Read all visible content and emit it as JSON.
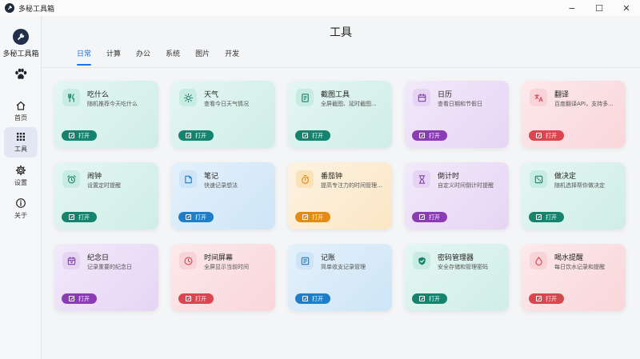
{
  "window": {
    "title": "多秘工具箱",
    "minimize": "−",
    "maximize": "☐",
    "close": "✕"
  },
  "sidebar": {
    "brand": "多秘工具箱",
    "items": [
      {
        "label": "首页",
        "icon": "home-icon"
      },
      {
        "label": "工具",
        "icon": "grid-icon",
        "active": true
      },
      {
        "label": "设置",
        "icon": "gear-icon"
      },
      {
        "label": "关于",
        "icon": "info-icon"
      }
    ]
  },
  "page": {
    "title": "工具"
  },
  "tabs": [
    {
      "label": "日常",
      "active": true
    },
    {
      "label": "计算"
    },
    {
      "label": "办公"
    },
    {
      "label": "系统"
    },
    {
      "label": "图片"
    },
    {
      "label": "开发"
    }
  ],
  "open_label": "打开",
  "colors": {
    "teal": "#16836f",
    "blue": "#1e7fc8",
    "purple": "#8a3cb4",
    "pink": "#d9464f",
    "orange": "#e48a16",
    "accent": "#1a73e8"
  },
  "tools": [
    {
      "name": "吃什么",
      "desc": "随机推荐今天吃什么",
      "icon": "fork-knife-icon",
      "theme": "teal"
    },
    {
      "name": "天气",
      "desc": "查看今日天气情况",
      "icon": "sun-icon",
      "theme": "teal"
    },
    {
      "name": "截图工具",
      "desc": "全屏截图、延时截图...",
      "icon": "screenshot-icon",
      "theme": "teal"
    },
    {
      "name": "日历",
      "desc": "查看日期和节假日",
      "icon": "calendar-icon",
      "theme": "purple"
    },
    {
      "name": "翻译",
      "desc": "百度翻译API，支持多...",
      "icon": "translate-icon",
      "theme": "pink"
    },
    {
      "name": "闹钟",
      "desc": "设置定时提醒",
      "icon": "alarm-icon",
      "theme": "teal"
    },
    {
      "name": "笔记",
      "desc": "快速记录想法",
      "icon": "note-icon",
      "theme": "blue"
    },
    {
      "name": "番茄钟",
      "desc": "提高专注力的时间管理...",
      "icon": "timer-icon",
      "theme": "orange"
    },
    {
      "name": "倒计时",
      "desc": "自定义时间倒计时提醒",
      "icon": "hourglass-icon",
      "theme": "purple"
    },
    {
      "name": "做决定",
      "desc": "随机选择帮你做决定",
      "icon": "dice-icon",
      "theme": "teal"
    },
    {
      "name": "纪念日",
      "desc": "记录重要的纪念日",
      "icon": "calendar-heart-icon",
      "theme": "purple"
    },
    {
      "name": "时间屏幕",
      "desc": "全屏显示当前时间",
      "icon": "clock-icon",
      "theme": "pink"
    },
    {
      "name": "记账",
      "desc": "简单收支记录管理",
      "icon": "ledger-icon",
      "theme": "blue"
    },
    {
      "name": "密码管理器",
      "desc": "安全存储和管理密码",
      "icon": "shield-check-icon",
      "theme": "teal"
    },
    {
      "name": "喝水提醒",
      "desc": "每日饮水记录和提醒",
      "icon": "water-drop-icon",
      "theme": "pink"
    }
  ]
}
